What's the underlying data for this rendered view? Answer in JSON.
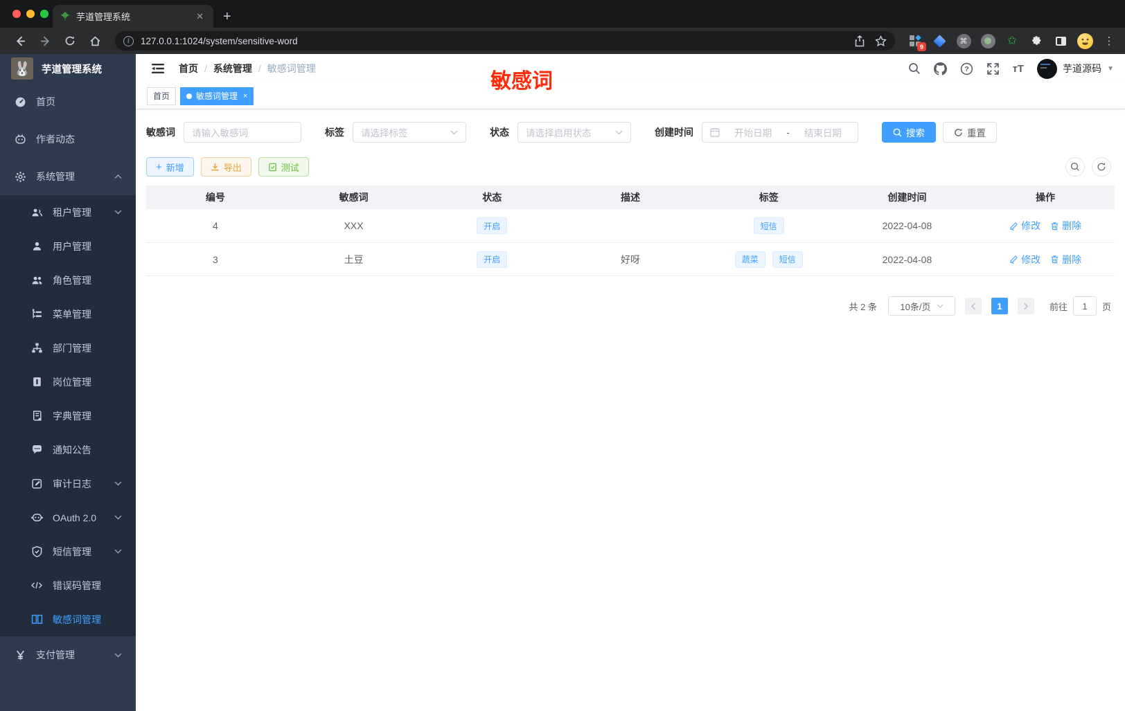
{
  "colors": {
    "accent": "#409eff",
    "annotation_red": "#fe2c0d",
    "warning": "#e6a23c",
    "success": "#67c23a",
    "sidebar_bg": "#2e3b4e",
    "submenu_bg": "#212d3d"
  },
  "browser": {
    "tab_title": "芋道管理系统",
    "url": "127.0.0.1:1024/system/sensitive-word",
    "extension_badge": "9"
  },
  "sidebar": {
    "app_title": "芋道管理系统",
    "items": [
      {
        "label": "首页",
        "icon": "dashboard-icon",
        "level": "top"
      },
      {
        "label": "作者动态",
        "icon": "author-icon",
        "level": "top"
      },
      {
        "label": "系统管理",
        "icon": "gear-icon",
        "level": "top",
        "chevron": "up"
      },
      {
        "label": "租户管理",
        "icon": "tenant-icon",
        "level": "sub",
        "chevron": "down"
      },
      {
        "label": "用户管理",
        "icon": "user-icon",
        "level": "sub"
      },
      {
        "label": "角色管理",
        "icon": "role-icon",
        "level": "sub"
      },
      {
        "label": "菜单管理",
        "icon": "menu-tree-icon",
        "level": "sub"
      },
      {
        "label": "部门管理",
        "icon": "org-icon",
        "level": "sub"
      },
      {
        "label": "岗位管理",
        "icon": "post-icon",
        "level": "sub"
      },
      {
        "label": "字典管理",
        "icon": "dict-icon",
        "level": "sub"
      },
      {
        "label": "通知公告",
        "icon": "notice-icon",
        "level": "sub"
      },
      {
        "label": "审计日志",
        "icon": "audit-icon",
        "level": "sub",
        "chevron": "down"
      },
      {
        "label": "OAuth 2.0",
        "icon": "oauth-icon",
        "level": "sub",
        "chevron": "down"
      },
      {
        "label": "短信管理",
        "icon": "sms-icon",
        "level": "sub",
        "chevron": "down"
      },
      {
        "label": "错误码管理",
        "icon": "errorcode-icon",
        "level": "sub"
      },
      {
        "label": "敏感词管理",
        "icon": "open-book-icon",
        "level": "sub",
        "active": true
      },
      {
        "label": "支付管理",
        "icon": "pay-icon",
        "level": "top",
        "chevron": "down"
      }
    ]
  },
  "header": {
    "breadcrumb": [
      "首页",
      "系统管理",
      "敏感词管理"
    ],
    "annotation": "敏感词",
    "username": "芋道源码"
  },
  "route_tabs": [
    {
      "label": "首页",
      "active": false
    },
    {
      "label": "敏感词管理",
      "active": true,
      "closable": true
    }
  ],
  "filters": {
    "keyword_label": "敏感词",
    "keyword_placeholder": "请输入敏感词",
    "tag_label": "标签",
    "tag_placeholder": "请选择标签",
    "status_label": "状态",
    "status_placeholder": "请选择启用状态",
    "date_label": "创建时间",
    "date_start_placeholder": "开始日期",
    "date_separator": "-",
    "date_end_placeholder": "结束日期",
    "search_label": "搜索",
    "reset_label": "重置"
  },
  "toolbar": {
    "add_label": "新增",
    "export_label": "导出",
    "test_label": "测试"
  },
  "table": {
    "columns": [
      "编号",
      "敏感词",
      "状态",
      "描述",
      "标签",
      "创建时间",
      "操作"
    ],
    "edit_label": "修改",
    "delete_label": "删除",
    "rows": [
      {
        "id": "4",
        "word": "XXX",
        "status": "开启",
        "description": "",
        "tags": [
          "短信"
        ],
        "created": "2022-04-08"
      },
      {
        "id": "3",
        "word": "土豆",
        "status": "开启",
        "description": "好呀",
        "tags": [
          "蔬菜",
          "短信"
        ],
        "created": "2022-04-08"
      }
    ]
  },
  "pagination": {
    "total": "共 2 条",
    "page_size": "10条/页",
    "current_page": "1",
    "goto_label": "前往",
    "goto_value": "1",
    "page_unit": "页"
  }
}
